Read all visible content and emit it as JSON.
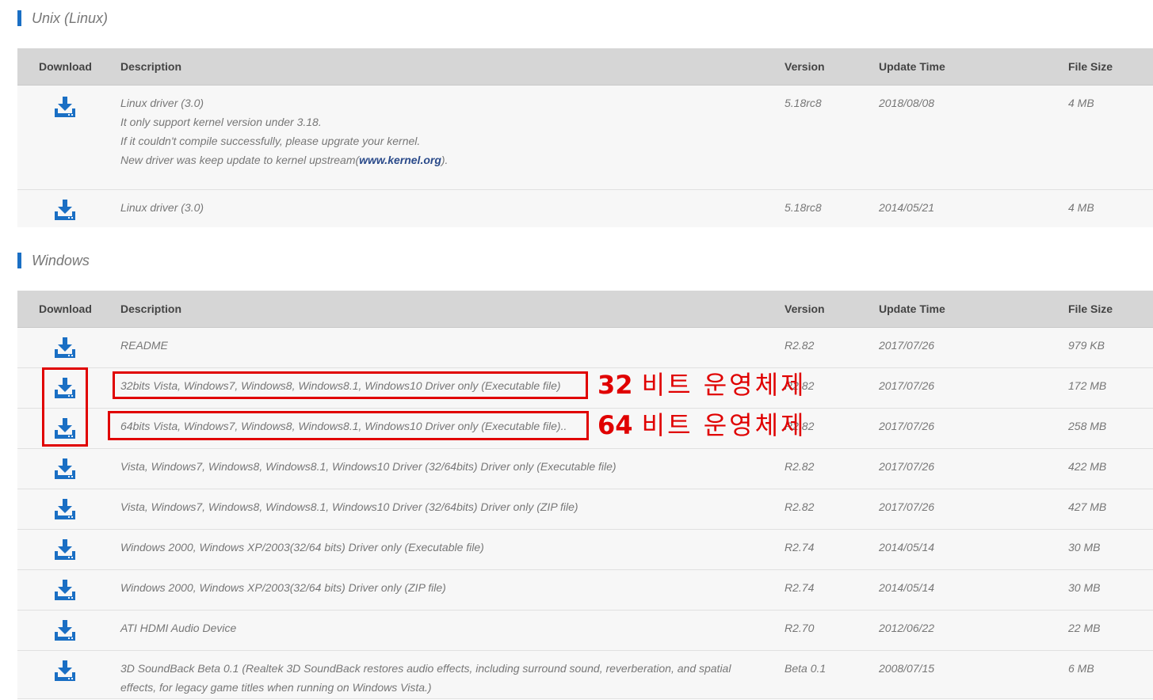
{
  "colors": {
    "accent": "#1a6fc4",
    "header_bg": "#d6d6d6",
    "row_bg": "#f7f7f7",
    "annotation": "#e00000"
  },
  "headers": {
    "download": "Download",
    "description": "Description",
    "version": "Version",
    "update_time": "Update Time",
    "file_size": "File Size"
  },
  "unix": {
    "title": "Unix (Linux)",
    "rows": [
      {
        "desc_line1": "Linux driver (3.0)",
        "desc_line2": "It only support kernel version under 3.18.",
        "desc_line3": "If it couldn't compile successfully, please upgrate your kernel.",
        "desc_line4_prefix": "New driver was keep update to kernel upstream(",
        "desc_line4_link": "www.kernel.org",
        "desc_line4_suffix": ").",
        "version": "5.18rc8",
        "time": "2018/08/08",
        "size": "4 MB"
      },
      {
        "desc": "Linux driver (3.0)",
        "version": "5.18rc8",
        "time": "2014/05/21",
        "size": "4 MB"
      }
    ]
  },
  "windows": {
    "title": "Windows",
    "rows": [
      {
        "desc": "README",
        "version": "R2.82",
        "time": "2017/07/26",
        "size": "979 KB"
      },
      {
        "desc": "32bits Vista, Windows7, Windows8, Windows8.1, Windows10 Driver only (Executable file)",
        "version": "R2.82",
        "time": "2017/07/26",
        "size": "172 MB"
      },
      {
        "desc": "64bits Vista, Windows7, Windows8, Windows8.1, Windows10 Driver only (Executable file)..",
        "version": "R2.82",
        "time": "2017/07/26",
        "size": "258 MB"
      },
      {
        "desc": "Vista, Windows7, Windows8, Windows8.1, Windows10 Driver (32/64bits) Driver only (Executable file)",
        "version": "R2.82",
        "time": "2017/07/26",
        "size": "422 MB"
      },
      {
        "desc": "Vista, Windows7, Windows8, Windows8.1, Windows10 Driver (32/64bits) Driver only (ZIP file)",
        "version": "R2.82",
        "time": "2017/07/26",
        "size": "427 MB"
      },
      {
        "desc": "Windows 2000, Windows XP/2003(32/64 bits) Driver only (Executable file)",
        "version": "R2.74",
        "time": "2014/05/14",
        "size": "30 MB"
      },
      {
        "desc": "Windows 2000, Windows XP/2003(32/64 bits) Driver only (ZIP file)",
        "version": "R2.74",
        "time": "2014/05/14",
        "size": "30 MB"
      },
      {
        "desc": "ATI HDMI Audio Device",
        "version": "R2.70",
        "time": "2012/06/22",
        "size": "22 MB"
      },
      {
        "desc": "3D SoundBack Beta 0.1 (Realtek 3D SoundBack restores audio effects, including surround sound, reverberation, and spatial effects, for legacy game titles when running on Windows Vista.)",
        "version": "Beta 0.1",
        "time": "2008/07/15",
        "size": "6 MB"
      }
    ]
  },
  "annotations": {
    "a32_num": "32",
    "a32_text": "비트 운영체제",
    "a64_num": "64",
    "a64_text": "비트 운영체제"
  },
  "icons": {
    "download": "download-icon"
  }
}
